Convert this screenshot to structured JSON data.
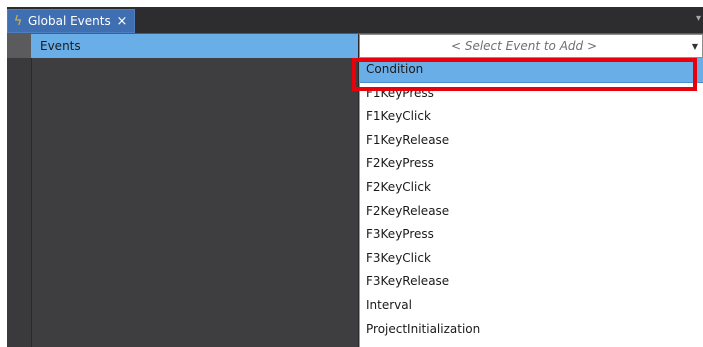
{
  "tab": {
    "label": "Global Events",
    "close_glyph": "×"
  },
  "grid": {
    "header_label": "Events"
  },
  "select": {
    "placeholder": "< Select Event to Add >",
    "arrow": "▼"
  },
  "dropdown": {
    "items": [
      "Condition",
      "F1KeyPress",
      "F1KeyClick",
      "F1KeyRelease",
      "F2KeyPress",
      "F2KeyClick",
      "F2KeyRelease",
      "F3KeyPress",
      "F3KeyClick",
      "F3KeyRelease",
      "Interval",
      "ProjectInitialization"
    ],
    "selected_index": 0
  },
  "colors": {
    "selection": "#6aaee8",
    "highlight": "#e8000b",
    "panel_bg": "#3e3e40"
  },
  "icons": [
    "lightning-bolt-icon",
    "close-icon",
    "dropdown-arrow-icon"
  ]
}
